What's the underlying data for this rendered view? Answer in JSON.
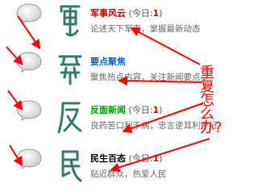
{
  "items": [
    {
      "title": "军事风云",
      "title_color": "#cc0000",
      "today_prefix": "(今日:",
      "count": "1",
      "today_suffix": ")",
      "desc": "论述天下军事，掌握最新动态",
      "icon": "calligraphy-jun-icon"
    },
    {
      "title": "要点聚焦",
      "title_color": "#0066cc",
      "today_prefix": "",
      "count": "",
      "today_suffix": "",
      "desc": "聚焦热点内容，关注新闻要点",
      "icon": "calligraphy-yao-icon"
    },
    {
      "title": "反面新闻",
      "title_color": "#009900",
      "today_prefix": "(今日:",
      "count": "1",
      "today_suffix": ")",
      "desc": "良药苦口利于病，忠言逆耳利于行",
      "icon": "calligraphy-fan-icon"
    },
    {
      "title": "民生百态",
      "title_color": "#000000",
      "today_prefix": "(今日:",
      "count": "1",
      "today_suffix": ")",
      "desc": "贴近群众，热爱人民",
      "icon": "calligraphy-min-icon"
    }
  ],
  "annotation": {
    "text": "重复怎么办?",
    "color": "#ff0000"
  },
  "accent": "#ff0000"
}
